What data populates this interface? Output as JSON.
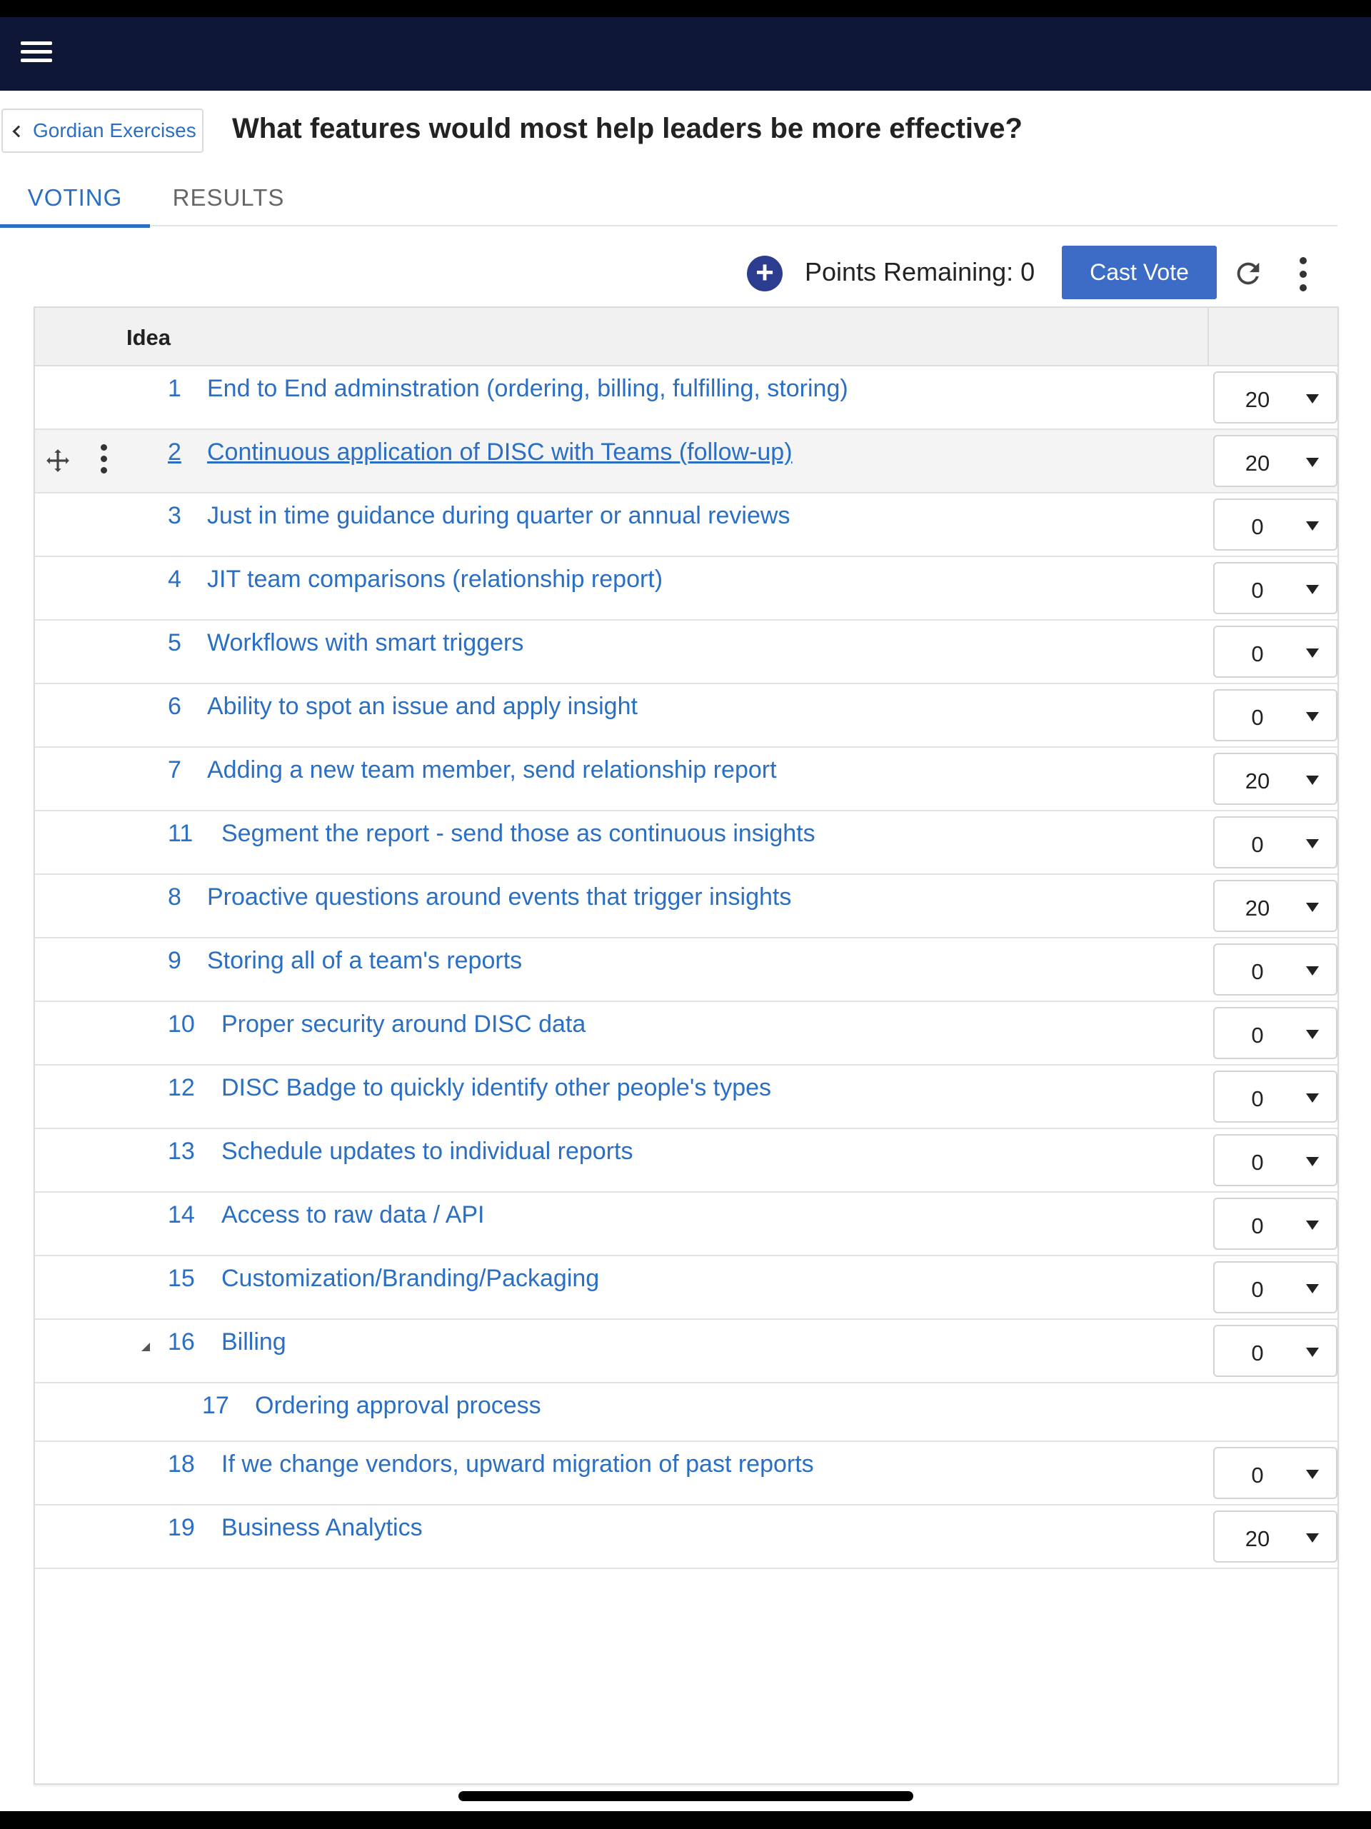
{
  "header": {
    "menu_icon": "hamburger-menu-icon",
    "colors": {
      "nav_background": "#0e1836",
      "accent": "#2a6fc4",
      "primary_button": "#3d6cc7"
    }
  },
  "breadcrumb": {
    "back_label": "Gordian Exercises"
  },
  "page": {
    "title": "What features would most help leaders be more effective?"
  },
  "tabs": [
    {
      "label": "VOTING",
      "active": true
    },
    {
      "label": "RESULTS",
      "active": false
    }
  ],
  "toolbar": {
    "points_remaining": "Points Remaining: 0",
    "cast_vote_label": "Cast Vote"
  },
  "grid": {
    "column_idea": "Idea",
    "rows": [
      {
        "num": "1",
        "text": "End to End adminstration (ordering, billing, fulfilling, storing)",
        "value": "20"
      },
      {
        "num": "2",
        "text": "Continuous application of DISC with Teams (follow-up)",
        "value": "20"
      },
      {
        "num": "3",
        "text": "Just in time guidance during quarter or annual reviews",
        "value": "0"
      },
      {
        "num": "4",
        "text": "JIT team comparisons (relationship report)",
        "value": "0"
      },
      {
        "num": "5",
        "text": "Workflows with smart triggers",
        "value": "0"
      },
      {
        "num": "6",
        "text": "Ability to spot an issue and apply insight",
        "value": "0"
      },
      {
        "num": "7",
        "text": "Adding a new team member, send relationship report",
        "value": "20"
      },
      {
        "num": "11",
        "text": "Segment the report - send those as continuous insights",
        "value": "0"
      },
      {
        "num": "8",
        "text": "Proactive questions around events that trigger insights",
        "value": "20"
      },
      {
        "num": "9",
        "text": "Storing all of a team's reports",
        "value": "0"
      },
      {
        "num": "10",
        "text": "Proper security around DISC data",
        "value": "0"
      },
      {
        "num": "12",
        "text": "DISC Badge to quickly identify other people's types",
        "value": "0"
      },
      {
        "num": "13",
        "text": "Schedule updates to individual reports",
        "value": "0"
      },
      {
        "num": "14",
        "text": "Access to raw data / API",
        "value": "0"
      },
      {
        "num": "15",
        "text": "Customization/Branding/Packaging",
        "value": "0"
      },
      {
        "num": "16",
        "text": "Billing",
        "value": "0"
      },
      {
        "num": "17",
        "text": "Ordering approval process"
      },
      {
        "num": "18",
        "text": "If we change vendors, upward migration of past reports",
        "value": "0"
      },
      {
        "num": "19",
        "text": "Business Analytics",
        "value": "20"
      }
    ]
  }
}
